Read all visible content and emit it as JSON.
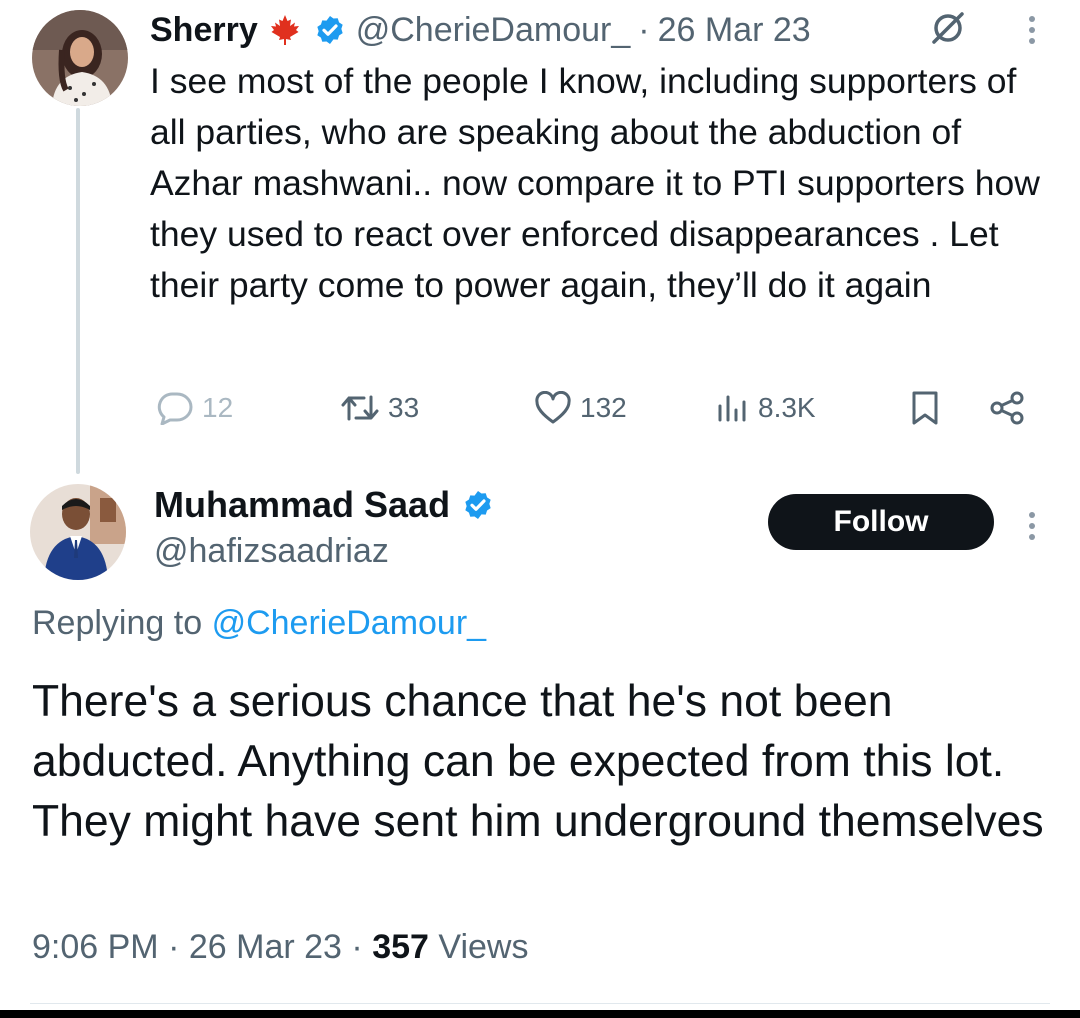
{
  "parent_tweet": {
    "author_name": "Sherry",
    "name_emoji": "maple-leaf",
    "handle": "@CherieDamour_",
    "separator": "·",
    "date": "26 Mar 23",
    "text": "I see most of the people I know, including supporters of all parties, who are speaking about the abduction of Azhar mashwani.. now compare it to PTI supporters how they used to react over enforced disappearances . Let their party come to power again, they’ll do it again",
    "stats": {
      "replies": "12",
      "retweets": "33",
      "likes": "132",
      "views": "8.3K"
    }
  },
  "reply_tweet": {
    "author_name": "Muhammad Saad",
    "handle": "@hafizsaadriaz",
    "follow_label": "Follow",
    "replying_prefix": "Replying to",
    "replying_to": "@CherieDamour_",
    "text": "There's a serious chance that he's not been abducted. Anything can be expected from this lot. They might have sent him underground themselves",
    "time": "9:06 PM",
    "date": "26 Mar 23",
    "separator": "·",
    "views_count": "357",
    "views_label": "Views"
  },
  "colors": {
    "text_primary": "#0f1419",
    "text_secondary": "#536471",
    "link": "#1d9bf0",
    "verified": "#1d9bf0",
    "follow_bg": "#0f1419",
    "maple_leaf": "#e0301e"
  },
  "icons": [
    "verified-badge-icon",
    "maple-leaf-icon",
    "grok-icon",
    "more-icon",
    "reply-icon",
    "retweet-icon",
    "like-icon",
    "views-icon",
    "bookmark-icon",
    "share-icon"
  ]
}
